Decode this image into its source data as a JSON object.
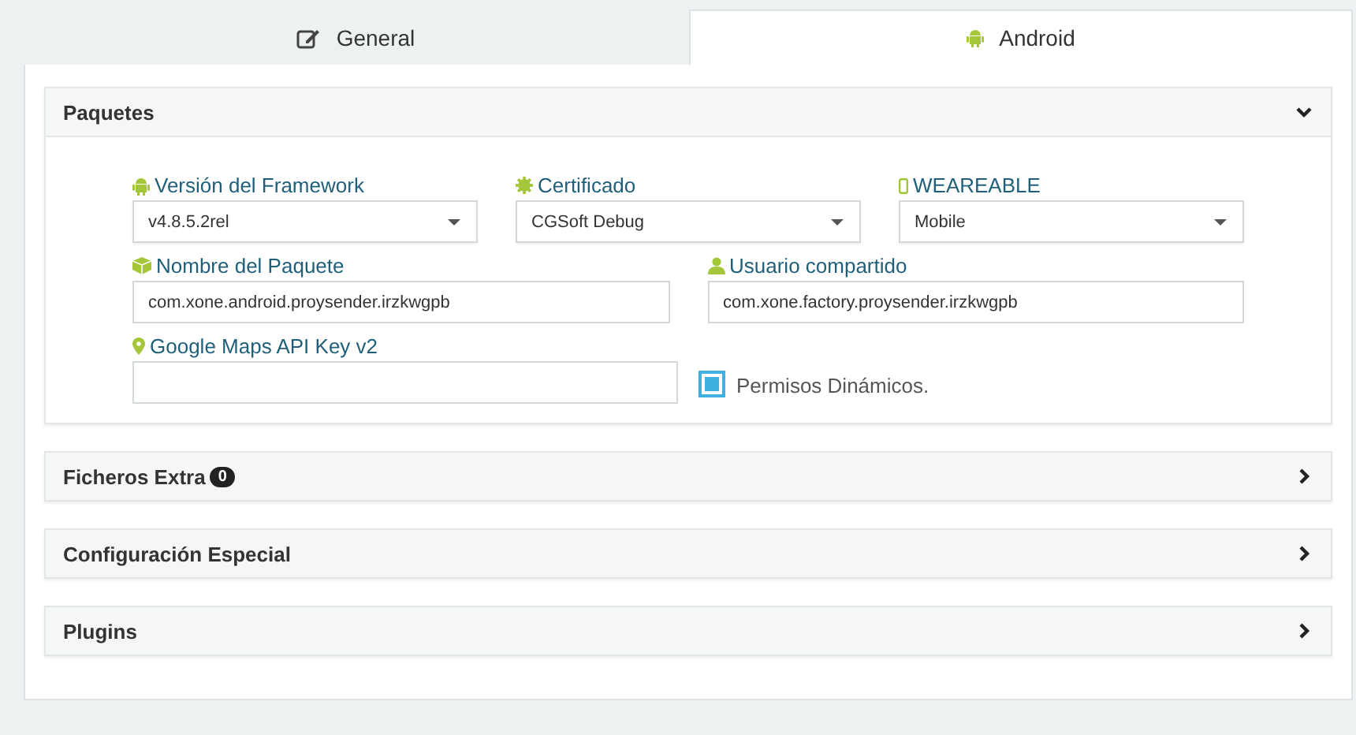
{
  "tabs": [
    {
      "label": "General",
      "selected": false
    },
    {
      "label": "Android",
      "selected": true
    }
  ],
  "panels": [
    {
      "title": "Paquetes",
      "expanded": true,
      "rows": [
        [
          {
            "kind": "select",
            "label": "Versión del Framework",
            "value": "v4.8.5.2rel"
          },
          {
            "kind": "select",
            "label": "Certificado",
            "value": "CGSoft Debug"
          },
          {
            "kind": "select",
            "label": "WEAREABLE",
            "value": "Mobile"
          }
        ],
        [
          {
            "kind": "input",
            "label": "Nombre del Paquete",
            "value": "com.xone.android.proysender.irzkwgpb"
          },
          {
            "kind": "input",
            "label": "Usuario compartido",
            "value": "com.xone.factory.proysender.irzkwgpb"
          }
        ],
        [
          {
            "kind": "input",
            "label": "Google Maps API Key v2"
          },
          {
            "kind": "checkbox",
            "label": "Permisos Dinámicos.",
            "checked": true
          }
        ]
      ]
    },
    {
      "title": "Ficheros Extra",
      "badge": "0",
      "expanded": false
    },
    {
      "title": "Configuración Especial",
      "expanded": false
    },
    {
      "title": "Plugins",
      "expanded": false
    }
  ]
}
